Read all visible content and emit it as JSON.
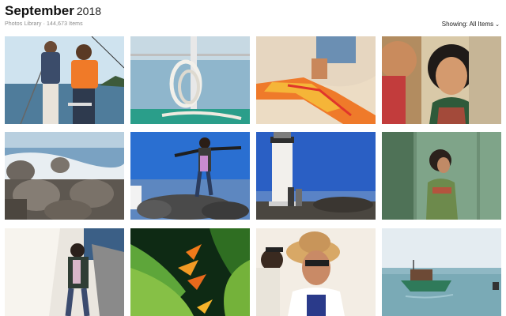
{
  "header": {
    "month": "September",
    "year": "2018",
    "subtitle": "Photos Library · 144,673 Items",
    "filter_label": "Showing: All Items"
  },
  "photos": [
    {
      "name": "kids-on-boat-photo",
      "scene": "children in life vests on a sailboat by the sea"
    },
    {
      "name": "boat-rope-photo",
      "scene": "coiled rope on a boat rail"
    },
    {
      "name": "beach-scarf-photo",
      "scene": "orange scarf over sand"
    },
    {
      "name": "smiling-women-photo",
      "scene": "two women smiling"
    },
    {
      "name": "breakwater-rocks-photo",
      "scene": "concrete tetrapods and waves"
    },
    {
      "name": "person-jumping-photo",
      "scene": "person balancing on rocks under blue sky"
    },
    {
      "name": "lighthouse-photo",
      "scene": "lighthouse with two people"
    },
    {
      "name": "woman-green-wall-photo",
      "scene": "woman against green wall"
    },
    {
      "name": "woman-white-wall-photo",
      "scene": "woman by white wall"
    },
    {
      "name": "tropical-flower-photo",
      "scene": "orange heliconia flower"
    },
    {
      "name": "woman-sunhat-photo",
      "scene": "woman in straw hat and sunglasses"
    },
    {
      "name": "fishing-boat-photo",
      "scene": "small boat on calm sea"
    }
  ]
}
